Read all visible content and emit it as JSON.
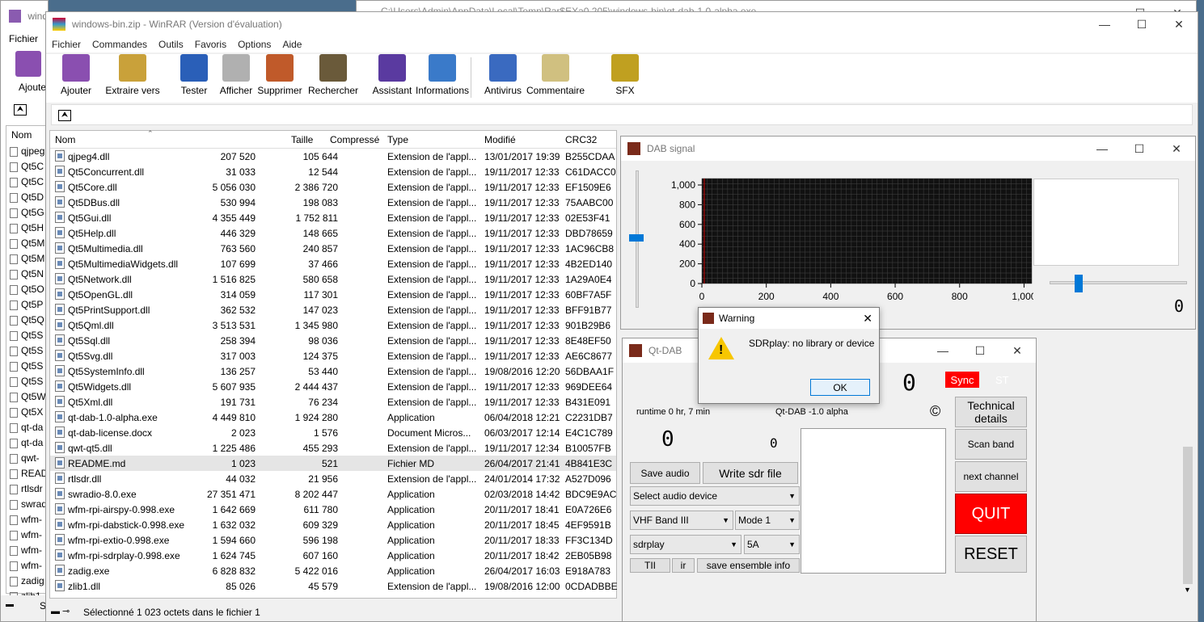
{
  "bg_window_title": "C:\\Users\\Admin\\AppData\\Local\\Temp\\Rar$EXa0.205\\windows-bin\\qt-dab-1.0-alpha.exe",
  "back_window": {
    "title": "wind",
    "menu": "Fichier",
    "tool_label": "Ajoute",
    "col_name": "Nom",
    "items": [
      "qjpeg",
      "Qt5C",
      "Qt5C",
      "Qt5D",
      "Qt5G",
      "Qt5H",
      "Qt5M",
      "Qt5M",
      "Qt5N",
      "Qt5O",
      "Qt5P",
      "Qt5Q",
      "Qt5S",
      "Qt5S",
      "Qt5S",
      "Qt5S",
      "Qt5W",
      "Qt5X",
      "qt-da",
      "qt-da",
      "qwt-",
      "READ",
      "rtlsdr",
      "swrad",
      "wfm-",
      "wfm-",
      "wfm-",
      "wfm-",
      "zadig",
      "zlib1."
    ],
    "status": "Se"
  },
  "winrar": {
    "title": "windows-bin.zip - WinRAR (Version d'évaluation)",
    "menu": [
      "Fichier",
      "Commandes",
      "Outils",
      "Favoris",
      "Options",
      "Aide"
    ],
    "toolbar": [
      "Ajouter",
      "Extraire vers",
      "Tester",
      "Afficher",
      "Supprimer",
      "Rechercher",
      "Assistant",
      "Informations",
      "Antivirus",
      "Commentaire",
      "SFX"
    ],
    "columns": [
      "Nom",
      "Taille",
      "Compressé",
      "Type",
      "Modifié",
      "CRC32"
    ],
    "files": [
      [
        "qjpeg4.dll",
        "207 520",
        "105 644",
        "Extension de l'appl...",
        "13/01/2017 19:39",
        "B255CDAA"
      ],
      [
        "Qt5Concurrent.dll",
        "31 033",
        "12 544",
        "Extension de l'appl...",
        "19/11/2017 12:33",
        "C61DACC0"
      ],
      [
        "Qt5Core.dll",
        "5 056 030",
        "2 386 720",
        "Extension de l'appl...",
        "19/11/2017 12:33",
        "EF1509E6"
      ],
      [
        "Qt5DBus.dll",
        "530 994",
        "198 083",
        "Extension de l'appl...",
        "19/11/2017 12:33",
        "75AABC00"
      ],
      [
        "Qt5Gui.dll",
        "4 355 449",
        "1 752 811",
        "Extension de l'appl...",
        "19/11/2017 12:33",
        "02E53F41"
      ],
      [
        "Qt5Help.dll",
        "446 329",
        "148 665",
        "Extension de l'appl...",
        "19/11/2017 12:33",
        "DBD78659"
      ],
      [
        "Qt5Multimedia.dll",
        "763 560",
        "240 857",
        "Extension de l'appl...",
        "19/11/2017 12:33",
        "1AC96CB8"
      ],
      [
        "Qt5MultimediaWidgets.dll",
        "107 699",
        "37 466",
        "Extension de l'appl...",
        "19/11/2017 12:33",
        "4B2ED140"
      ],
      [
        "Qt5Network.dll",
        "1 516 825",
        "580 658",
        "Extension de l'appl...",
        "19/11/2017 12:33",
        "1A29A0E4"
      ],
      [
        "Qt5OpenGL.dll",
        "314 059",
        "117 301",
        "Extension de l'appl...",
        "19/11/2017 12:33",
        "60BF7A5F"
      ],
      [
        "Qt5PrintSupport.dll",
        "362 532",
        "147 023",
        "Extension de l'appl...",
        "19/11/2017 12:33",
        "BFF91B77"
      ],
      [
        "Qt5Qml.dll",
        "3 513 531",
        "1 345 980",
        "Extension de l'appl...",
        "19/11/2017 12:33",
        "901B29B6"
      ],
      [
        "Qt5Sql.dll",
        "258 394",
        "98 036",
        "Extension de l'appl...",
        "19/11/2017 12:33",
        "8E48EF50"
      ],
      [
        "Qt5Svg.dll",
        "317 003",
        "124 375",
        "Extension de l'appl...",
        "19/11/2017 12:33",
        "AE6C8677"
      ],
      [
        "Qt5SystemInfo.dll",
        "136 257",
        "53 440",
        "Extension de l'appl...",
        "19/08/2016 12:20",
        "56DBAA1F"
      ],
      [
        "Qt5Widgets.dll",
        "5 607 935",
        "2 444 437",
        "Extension de l'appl...",
        "19/11/2017 12:33",
        "969DEE64"
      ],
      [
        "Qt5Xml.dll",
        "191 731",
        "76 234",
        "Extension de l'appl...",
        "19/11/2017 12:33",
        "B431E091"
      ],
      [
        "qt-dab-1.0-alpha.exe",
        "4 449 810",
        "1 924 280",
        "Application",
        "06/04/2018 12:21",
        "C2231DB7"
      ],
      [
        "qt-dab-license.docx",
        "2 023",
        "1 576",
        "Document Micros...",
        "06/03/2017 12:14",
        "E4C1C789"
      ],
      [
        "qwt-qt5.dll",
        "1 225 486",
        "455 293",
        "Extension de l'appl...",
        "19/11/2017 12:34",
        "B10057FB"
      ],
      [
        "README.md",
        "1 023",
        "521",
        "Fichier MD",
        "26/04/2017 21:41",
        "4B841E3C"
      ],
      [
        "rtlsdr.dll",
        "44 032",
        "21 956",
        "Extension de l'appl...",
        "24/01/2014 17:32",
        "A527D096"
      ],
      [
        "swradio-8.0.exe",
        "27 351 471",
        "8 202 447",
        "Application",
        "02/03/2018 14:42",
        "BDC9E9AC"
      ],
      [
        "wfm-rpi-airspy-0.998.exe",
        "1 642 669",
        "611 780",
        "Application",
        "20/11/2017 18:41",
        "E0A726E6"
      ],
      [
        "wfm-rpi-dabstick-0.998.exe",
        "1 632 032",
        "609 329",
        "Application",
        "20/11/2017 18:45",
        "4EF9591B"
      ],
      [
        "wfm-rpi-extio-0.998.exe",
        "1 594 660",
        "596 198",
        "Application",
        "20/11/2017 18:33",
        "FF3C134D"
      ],
      [
        "wfm-rpi-sdrplay-0.998.exe",
        "1 624 745",
        "607 160",
        "Application",
        "20/11/2017 18:42",
        "2EB05B98"
      ],
      [
        "zadig.exe",
        "6 828 832",
        "5 422 016",
        "Application",
        "26/04/2017 16:03",
        "E918A783"
      ],
      [
        "zlib1.dll",
        "85 026",
        "45 579",
        "Extension de l'appl...",
        "19/08/2016 12:00",
        "0CDADBBE"
      ]
    ],
    "selected_index": 20,
    "status": "Sélectionné 1 023 octets dans le fichier 1"
  },
  "dab_signal": {
    "title": "DAB signal",
    "right_digit": "0"
  },
  "chart_data": {
    "type": "line",
    "x_ticks": [
      "0",
      "200",
      "400",
      "600",
      "800",
      "1,000"
    ],
    "y_ticks": [
      "1,000",
      "800",
      "600",
      "400",
      "200",
      "0"
    ],
    "xlim": [
      0,
      1024
    ],
    "ylim": [
      0,
      1000
    ],
    "grid": true,
    "series": []
  },
  "qtdab": {
    "title": "Qt-DAB",
    "big_digit": "0",
    "sync": "Sync",
    "st": "ST",
    "runtime": "runtime 0 hr, 7 min",
    "version": "Qt-DAB -1.0 alpha",
    "copyright": "©",
    "digit_a": "0",
    "digit_b": "0",
    "save_audio": "Save audio",
    "write_sdr": "Write sdr file",
    "audio_device": "Select audio device",
    "band": "VHF Band III",
    "mode": "Mode 1",
    "device": "sdrplay",
    "channel": "5A",
    "tii": "TII",
    "ir": "ir",
    "save_ensemble": "save ensemble info",
    "technical": "Technical details",
    "scan_band": "Scan band",
    "next_channel": "next channel",
    "quit": "QUIT",
    "reset": "RESET"
  },
  "warning": {
    "title": "Warning",
    "message": "SDRplay: no library or device",
    "ok": "OK"
  }
}
